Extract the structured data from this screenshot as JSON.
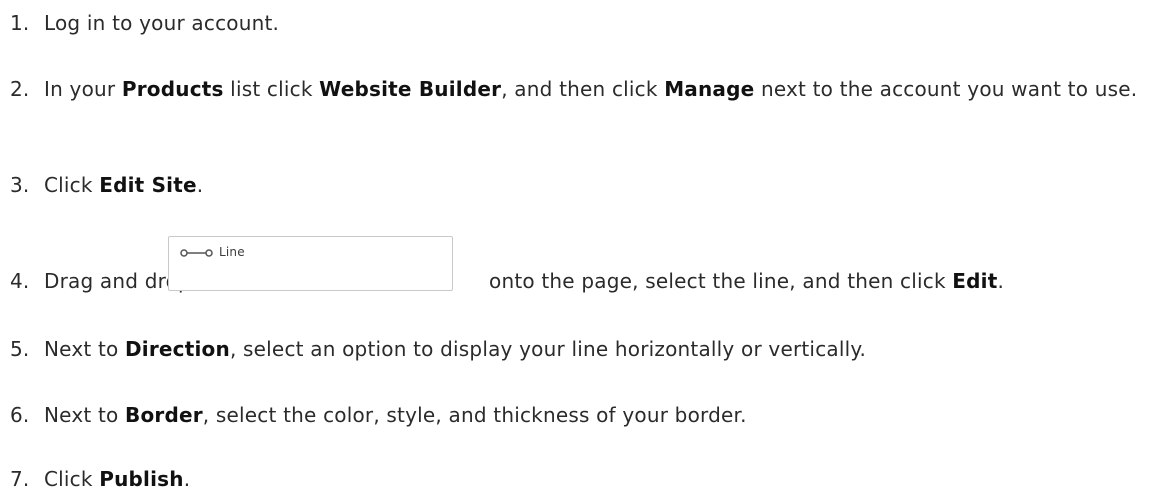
{
  "steps": [
    {
      "number": "1.",
      "parts": [
        "Log in to your account."
      ]
    },
    {
      "number": "2.",
      "parts": [
        "In your ",
        "Products",
        " list click ",
        "Website Builder",
        ", and then click ",
        "Manage",
        " next to the account you want to use."
      ]
    },
    {
      "number": "3.",
      "parts": [
        "Click ",
        "Edit Site",
        "."
      ]
    },
    {
      "number": "4.",
      "parts": [
        "Drag and drop ",
        " onto the page, select the line, and then click ",
        "Edit",
        "."
      ]
    },
    {
      "number": "5.",
      "parts": [
        "Next to ",
        "Direction",
        ", select an option to display your line horizontally or vertically."
      ]
    },
    {
      "number": "6.",
      "parts": [
        "Next to ",
        "Border",
        ", select the color, style, and thickness of your border."
      ]
    },
    {
      "number": "7.",
      "parts": [
        "Click ",
        "Publish",
        "."
      ]
    }
  ],
  "line_widget": {
    "label": "Line",
    "icon": "line-connector-icon",
    "icon_color": "#555555",
    "border_color": "#c9c9c9"
  }
}
